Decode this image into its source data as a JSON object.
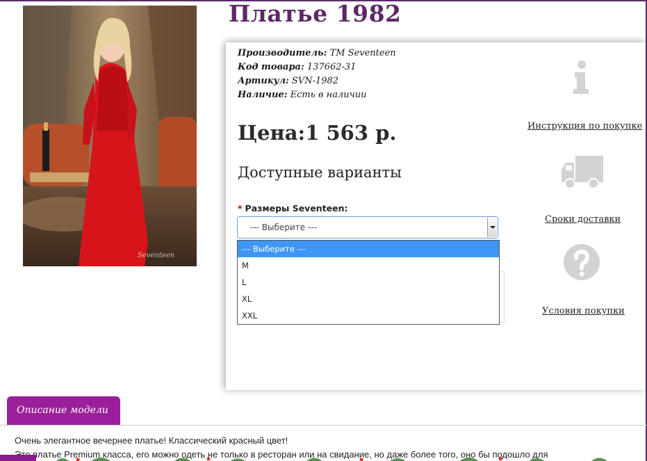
{
  "product": {
    "title": "Платье 1982",
    "manufacturer_label": "Производитель:",
    "manufacturer_value": "ТМ Seventeen",
    "code_label": "Код товара:",
    "code_value": "137662-31",
    "article_label": "Артикул:",
    "article_value": "SVN-1982",
    "availability_label": "Наличие:",
    "availability_value": "Есть в наличии",
    "price": "Цена:1 563 р.",
    "photo_watermark": "Seventeen"
  },
  "options": {
    "heading": "Доступные варианты",
    "size_label": "Размеры Seventeen:",
    "required_mark": "*",
    "selected": "--- Выберите ---",
    "list": [
      "--- Выберите ---",
      "M",
      "L",
      "XL",
      "XXL"
    ]
  },
  "links": {
    "instruction": "Инструкция по покупке",
    "delivery": "Сроки доставки",
    "conditions": "Условия покупки"
  },
  "icons": {
    "info": "info-icon",
    "truck": "truck-icon",
    "help": "question-icon"
  },
  "description": {
    "tab": "Описание модели",
    "line1": "Очень элегантное вечернее платье! Классический красный цвет!",
    "line2": "Это платье Premium класса, его можно одеть не только в ресторан или на свидание, но даже более того, оно бы подошло для"
  },
  "colors": {
    "brand": "#5b2866",
    "tab": "#9b1f9a",
    "selected_option": "#3d96f5",
    "icon_gray": "#d3d3d3"
  }
}
